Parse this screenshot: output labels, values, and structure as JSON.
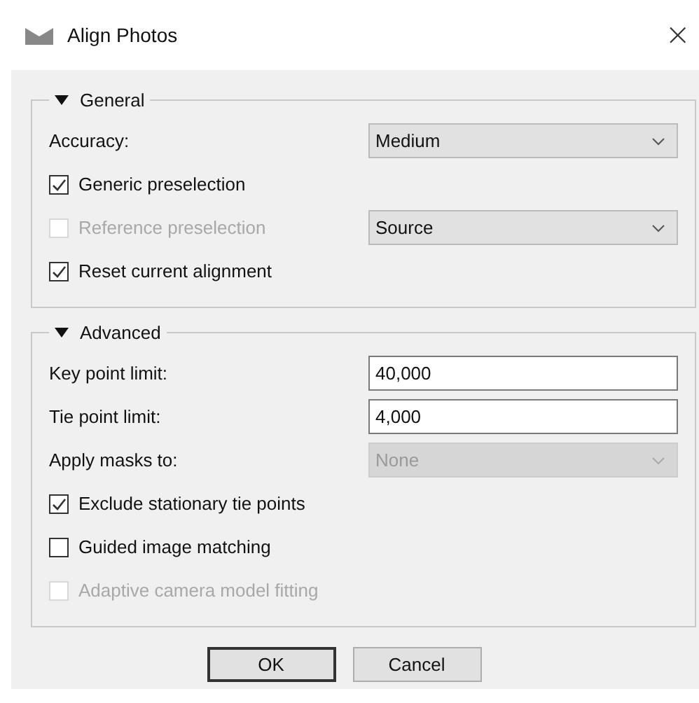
{
  "window": {
    "title": "Align Photos",
    "close": "×"
  },
  "groups": [
    {
      "title": "General",
      "expanded": true,
      "rows": [
        {
          "kind": "combo",
          "label": "Accuracy:",
          "value": "Medium",
          "disabled": false
        },
        {
          "kind": "checkbox",
          "label": "Generic preselection",
          "checked": true,
          "disabled": false
        },
        {
          "kind": "checkbox-combo",
          "label": "Reference preselection",
          "checked": false,
          "disabled": true,
          "value": "Source",
          "value_disabled": false
        },
        {
          "kind": "checkbox",
          "label": "Reset current alignment",
          "checked": true,
          "disabled": false
        }
      ]
    },
    {
      "title": "Advanced",
      "expanded": true,
      "rows": [
        {
          "kind": "field",
          "label": "Key point limit:",
          "value": "40,000"
        },
        {
          "kind": "field",
          "label": "Tie point limit:",
          "value": "4,000"
        },
        {
          "kind": "combo",
          "label": "Apply masks to:",
          "value": "None",
          "disabled": true
        },
        {
          "kind": "checkbox",
          "label": "Exclude stationary tie points",
          "checked": true,
          "disabled": false
        },
        {
          "kind": "checkbox",
          "label": "Guided image matching",
          "checked": false,
          "disabled": false
        },
        {
          "kind": "checkbox",
          "label": "Adaptive camera model fitting",
          "checked": false,
          "disabled": true
        }
      ]
    }
  ],
  "buttons": [
    {
      "label": "OK",
      "default": true
    },
    {
      "label": "Cancel",
      "default": false
    }
  ]
}
